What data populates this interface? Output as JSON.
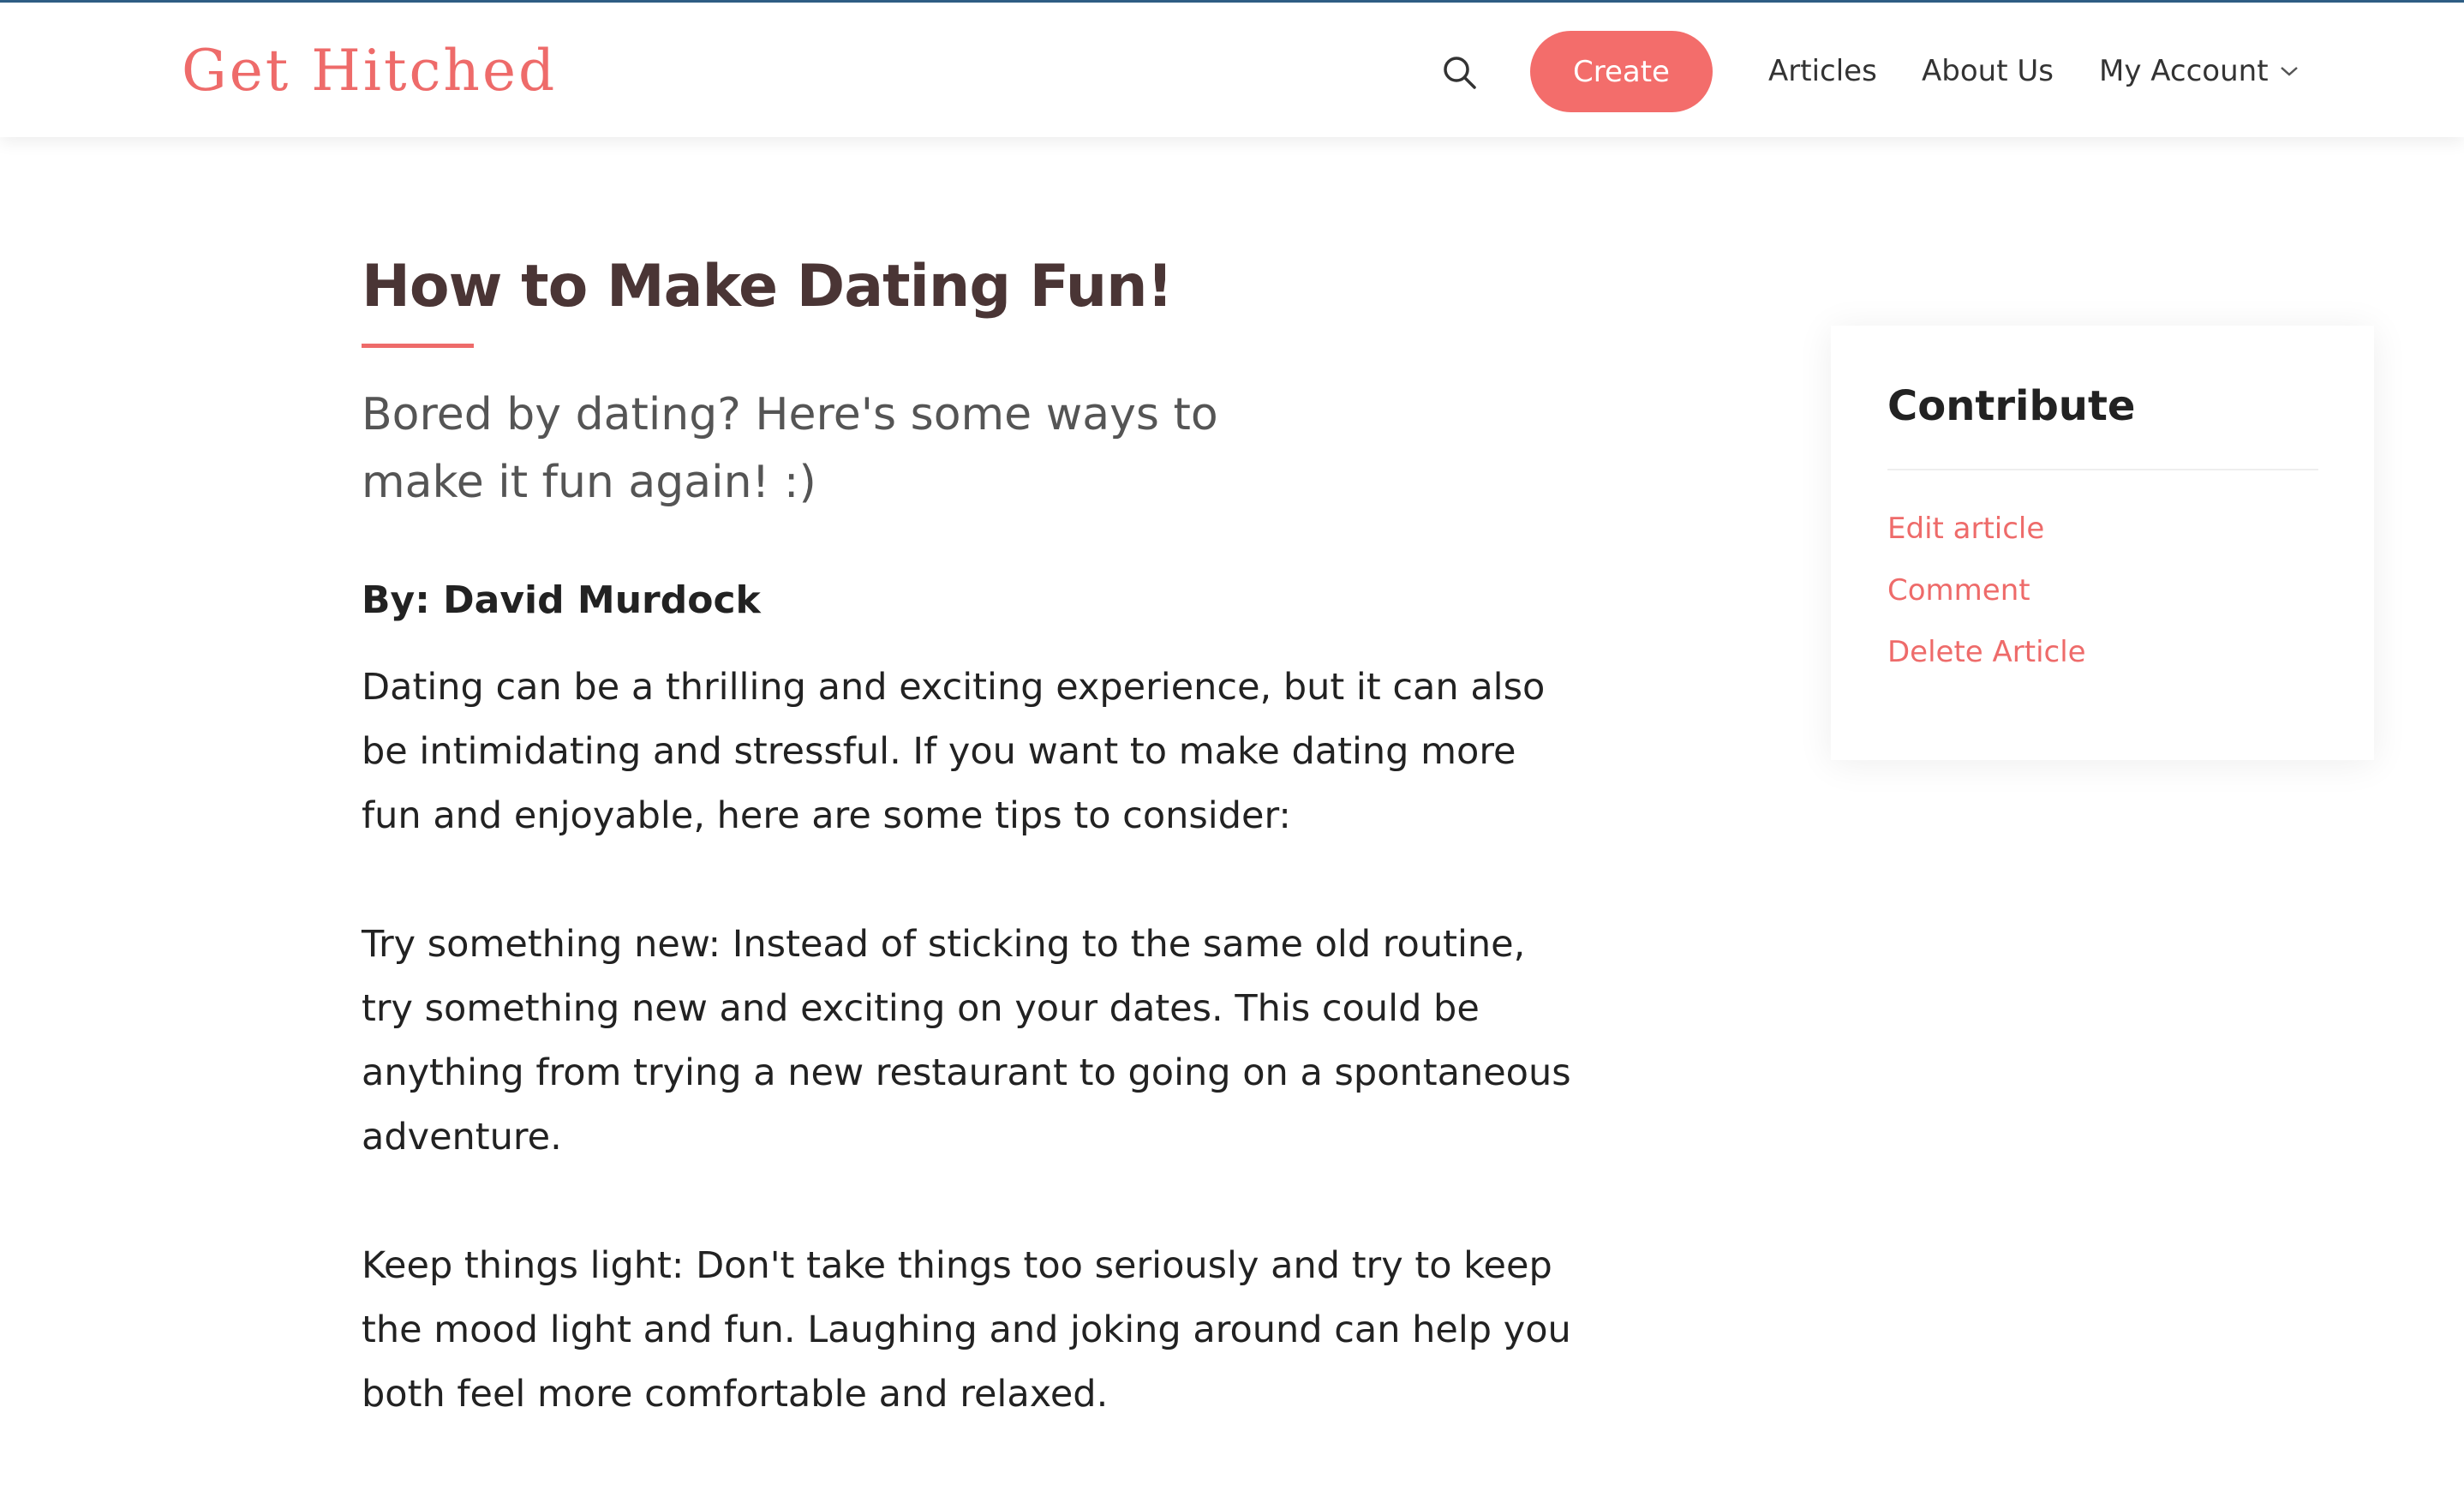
{
  "header": {
    "logo": "Get Hitched",
    "search_icon": "search-icon",
    "create_label": "Create",
    "nav": {
      "articles": "Articles",
      "about": "About Us",
      "account": "My Account"
    },
    "accent_color": "#f36d6b"
  },
  "article": {
    "title": "How to Make Dating Fun!",
    "subtitle": "Bored by dating? Here's some ways to make it fun again! :)",
    "byline": "By: David Murdock",
    "paragraphs": [
      "Dating can be a thrilling and exciting experience, but it can also be intimidating and stressful. If you want to make dating more fun and enjoyable, here are some tips to consider:",
      "Try something new: Instead of sticking to the same old routine, try something new and exciting on your dates. This could be anything from trying a new restaurant to going on a spontaneous adventure.",
      "Keep things light: Don't take things too seriously and try to keep the mood light and fun. Laughing and joking around can help you both feel more comfortable and relaxed."
    ]
  },
  "sidebar": {
    "title": "Contribute",
    "links": {
      "edit": "Edit article",
      "comment": "Comment",
      "delete": "Delete Article"
    }
  }
}
